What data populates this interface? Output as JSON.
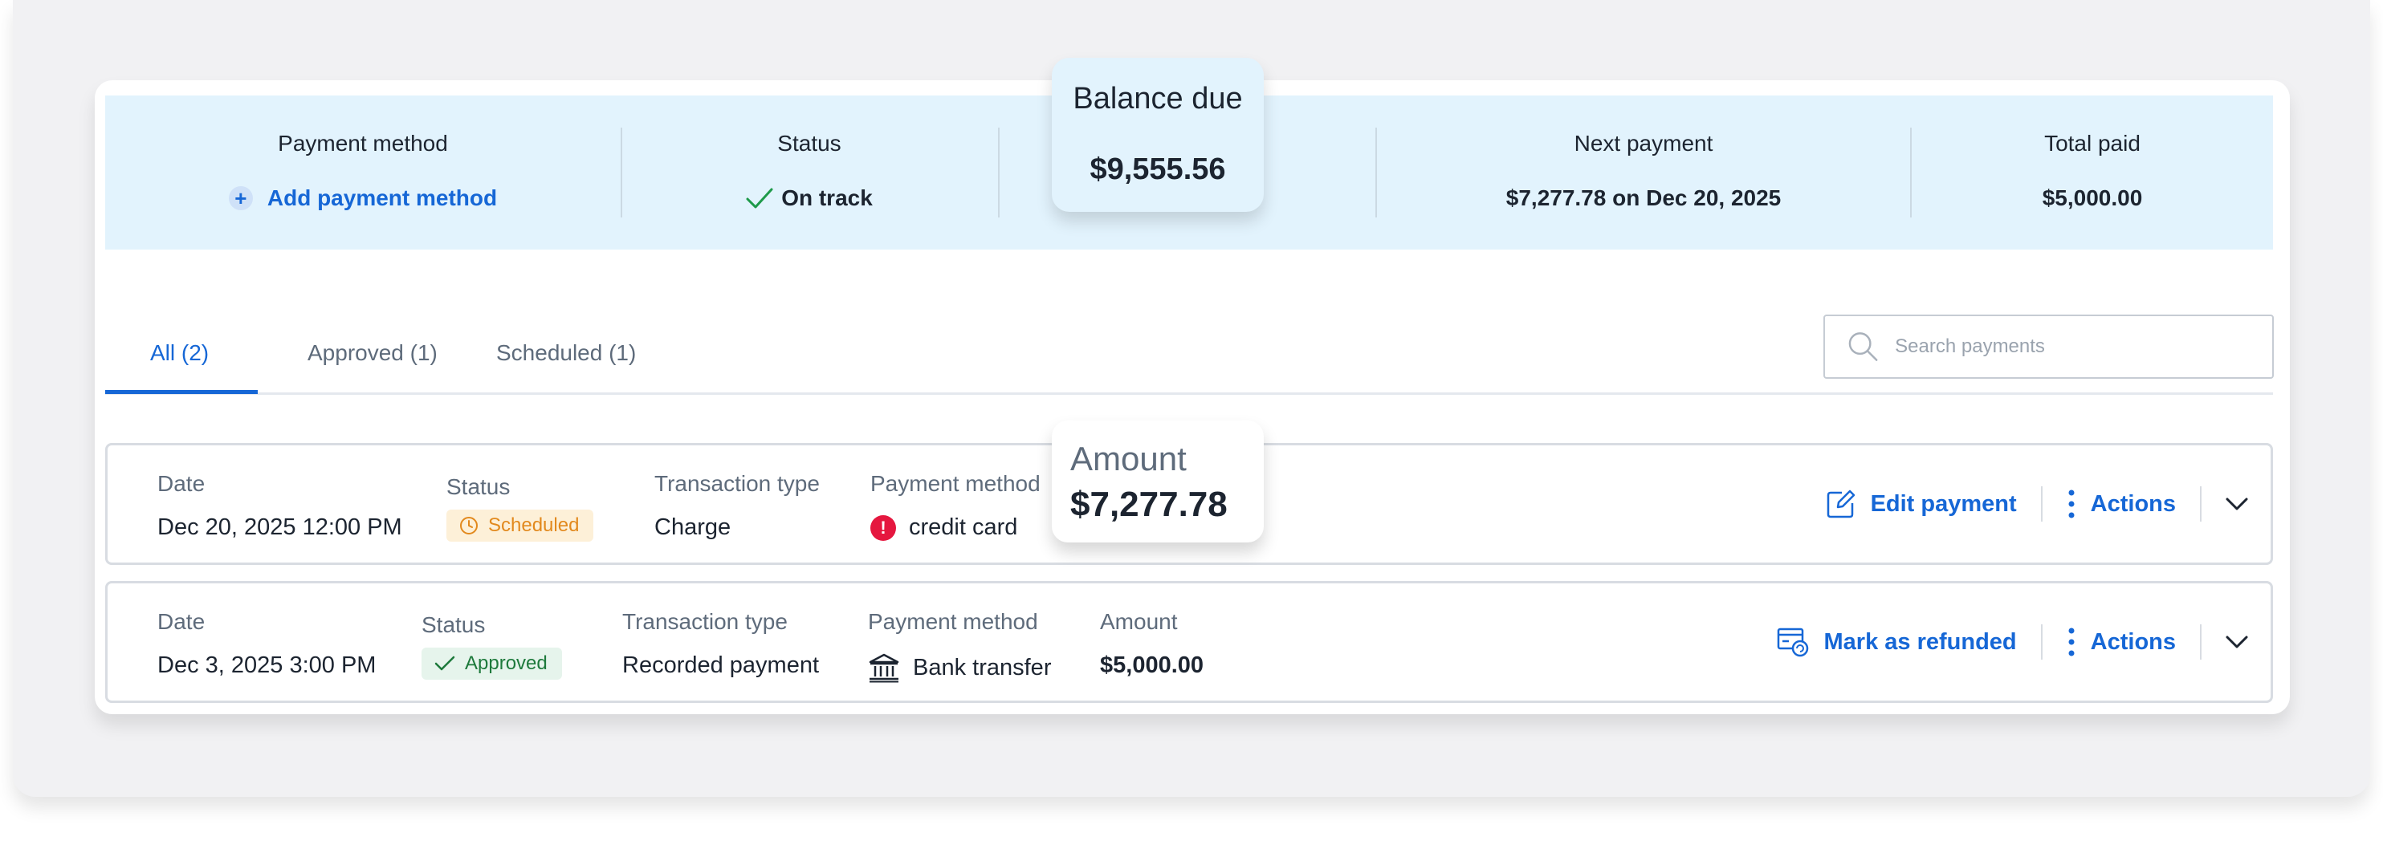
{
  "summary": {
    "payment_method_label": "Payment method",
    "add_payment_method": "Add payment method",
    "status_label": "Status",
    "status_value": "On track",
    "balance_label": "Balance due",
    "balance_value": "$9,555.56",
    "next_payment_label": "Next payment",
    "next_payment_value": "$7,277.78 on Dec 20, 2025",
    "total_paid_label": "Total paid",
    "total_paid_value": "$5,000.00"
  },
  "tabs": [
    {
      "label": "All (2)",
      "active": true
    },
    {
      "label": "Approved (1)",
      "active": false
    },
    {
      "label": "Scheduled (1)",
      "active": false
    }
  ],
  "search": {
    "placeholder": "Search payments"
  },
  "labels": {
    "date": "Date",
    "status": "Status",
    "transaction_type": "Transaction type",
    "payment_method": "Payment method",
    "amount": "Amount",
    "actions": "Actions"
  },
  "payments": [
    {
      "date": "Dec 20, 2025 12:00 PM",
      "status": "Scheduled",
      "transaction_type": "Charge",
      "payment_method": "credit card",
      "payment_method_icon": "error-icon",
      "amount": "$7,277.78",
      "primary_action": "Edit payment",
      "primary_action_icon": "edit-icon"
    },
    {
      "date": "Dec 3, 2025 3:00 PM",
      "status": "Approved",
      "transaction_type": "Recorded payment",
      "payment_method": "Bank transfer",
      "payment_method_icon": "bank-icon",
      "amount": "$5,000.00",
      "primary_action": "Mark as refunded",
      "primary_action_icon": "refund-icon"
    }
  ],
  "colors": {
    "accent": "#1667d6",
    "summary_bg": "#e2f3fd",
    "scheduled": "#e2891d",
    "approved": "#1e7a3c",
    "error": "#e5173f"
  }
}
